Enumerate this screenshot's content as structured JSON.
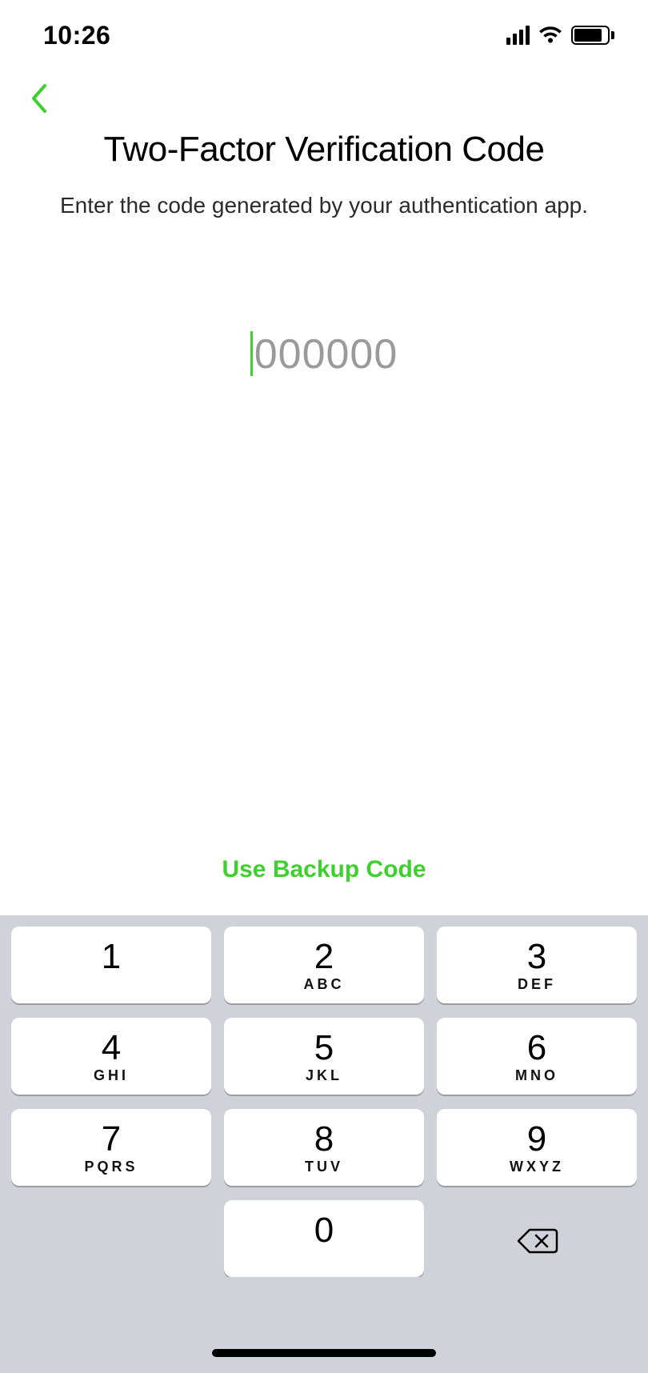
{
  "status": {
    "time": "10:26"
  },
  "colors": {
    "accent": "#3fcf2f"
  },
  "header": {
    "title": "Two-Factor Verification Code",
    "subtitle": "Enter the code generated by your authentication app."
  },
  "code_input": {
    "placeholder": "000000",
    "value": ""
  },
  "actions": {
    "backup_link": "Use Backup Code"
  },
  "keypad": {
    "keys": [
      {
        "digit": "1",
        "letters": ""
      },
      {
        "digit": "2",
        "letters": "ABC"
      },
      {
        "digit": "3",
        "letters": "DEF"
      },
      {
        "digit": "4",
        "letters": "GHI"
      },
      {
        "digit": "5",
        "letters": "JKL"
      },
      {
        "digit": "6",
        "letters": "MNO"
      },
      {
        "digit": "7",
        "letters": "PQRS"
      },
      {
        "digit": "8",
        "letters": "TUV"
      },
      {
        "digit": "9",
        "letters": "WXYZ"
      },
      {
        "digit": "",
        "letters": ""
      },
      {
        "digit": "0",
        "letters": ""
      },
      {
        "digit": "",
        "letters": ""
      }
    ]
  }
}
